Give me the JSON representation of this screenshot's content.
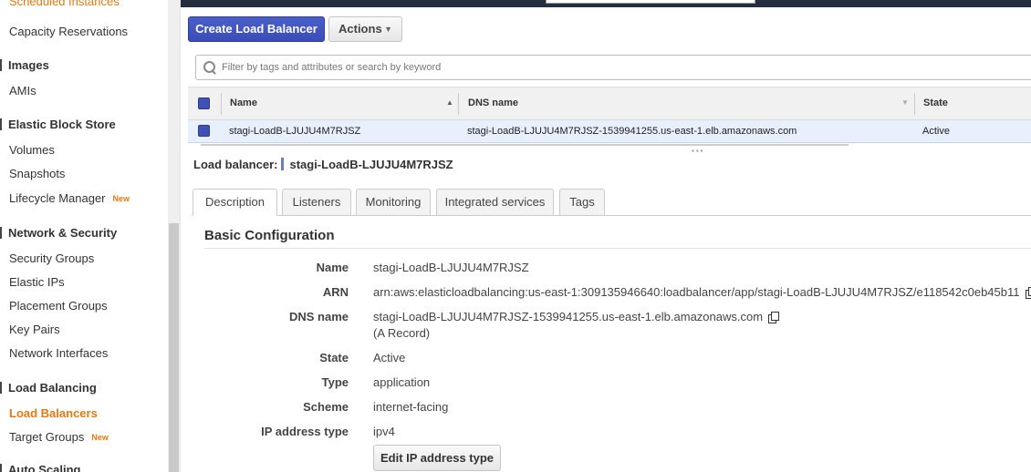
{
  "sidebar": {
    "items": [
      {
        "label": "Scheduled Instances"
      },
      {
        "label": "Capacity Reservations"
      },
      {
        "group": "Images"
      },
      {
        "label": "AMIs"
      },
      {
        "group": "Elastic Block Store"
      },
      {
        "label": "Volumes"
      },
      {
        "label": "Snapshots"
      },
      {
        "label": "Lifecycle Manager",
        "badge": "New"
      },
      {
        "group": "Network & Security"
      },
      {
        "label": "Security Groups"
      },
      {
        "label": "Elastic IPs"
      },
      {
        "label": "Placement Groups"
      },
      {
        "label": "Key Pairs"
      },
      {
        "label": "Network Interfaces"
      },
      {
        "group": "Load Balancing"
      },
      {
        "label": "Load Balancers",
        "active": true
      },
      {
        "label": "Target Groups",
        "badge": "New"
      },
      {
        "group": "Auto Scaling"
      }
    ]
  },
  "toolbar": {
    "create_label": "Create Load Balancer",
    "actions_label": "Actions"
  },
  "search": {
    "placeholder": "Filter by tags and attributes or search by keyword"
  },
  "table": {
    "headers": {
      "name": "Name",
      "dns": "DNS name",
      "state": "State"
    },
    "rows": [
      {
        "name": "stagi-LoadB-LJUJU4M7RJSZ",
        "dns": "stagi-LoadB-LJUJU4M7RJSZ-1539941255.us-east-1.elb.amazonaws.com",
        "state": "Active"
      }
    ]
  },
  "details": {
    "lb_prefix": "Load balancer:",
    "lb_name": "stagi-LoadB-LJUJU4M7RJSZ",
    "tabs": [
      "Description",
      "Listeners",
      "Monitoring",
      "Integrated services",
      "Tags"
    ],
    "active_tab": "Description",
    "section_title": "Basic Configuration",
    "fields": {
      "name": {
        "key": "Name",
        "value": "stagi-LoadB-LJUJU4M7RJSZ"
      },
      "arn": {
        "key": "ARN",
        "value": "arn:aws:elasticloadbalancing:us-east-1:309135946640:loadbalancer/app/stagi-LoadB-LJUJU4M7RJSZ/e118542c0eb45b11"
      },
      "dns": {
        "key": "DNS name",
        "value": "stagi-LoadB-LJUJU4M7RJSZ-1539941255.us-east-1.elb.amazonaws.com",
        "note": "(A Record)"
      },
      "state": {
        "key": "State",
        "value": "Active"
      },
      "type": {
        "key": "Type",
        "value": "application"
      },
      "scheme": {
        "key": "Scheme",
        "value": "internet-facing"
      },
      "ip_type": {
        "key": "IP address type",
        "value": "ipv4"
      }
    },
    "edit_ip_label": "Edit IP address type"
  },
  "colors": {
    "accent": "#3f51b5",
    "active_nav": "#e47911"
  }
}
